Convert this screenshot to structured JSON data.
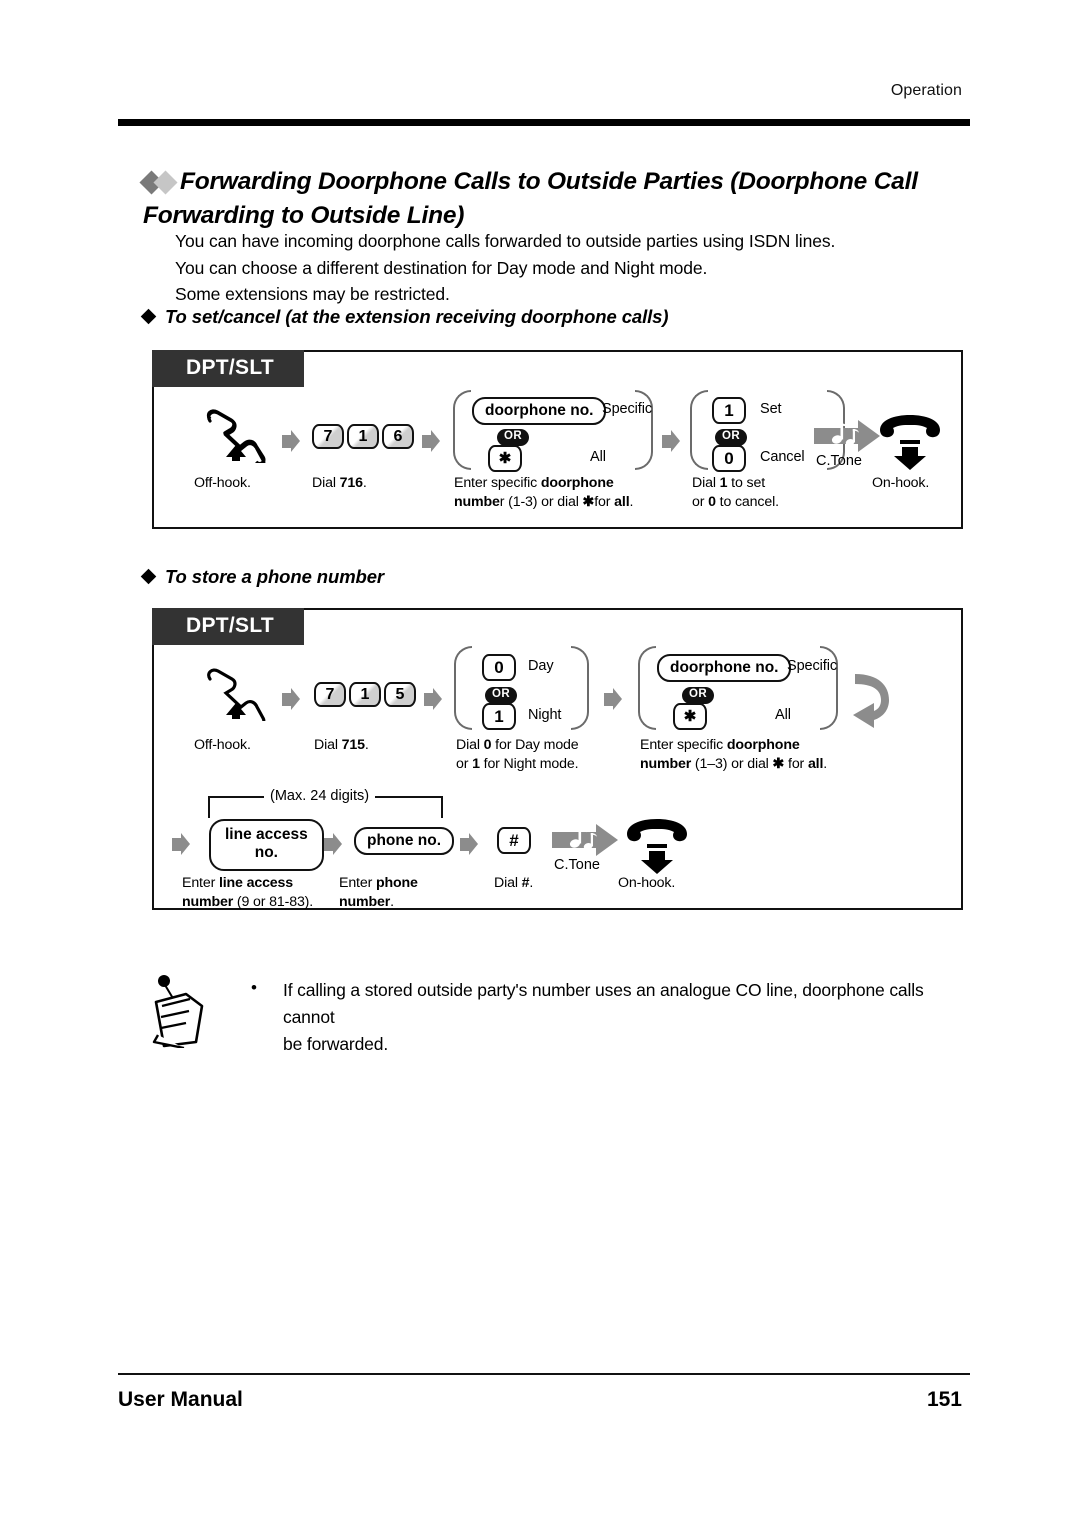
{
  "header": {
    "running_head": "Operation"
  },
  "section": {
    "title": "Forwarding Doorphone Calls to Outside Parties (Doorphone Call Forwarding to Outside Line)",
    "intro_lines": [
      "You can have incoming doorphone calls forwarded to outside parties using ISDN lines.",
      "You can choose a different destination for Day mode and Night mode.",
      "Some extensions may be restricted."
    ]
  },
  "proc1": {
    "heading": "To set/cancel (at the extension receiving doorphone calls)",
    "banner": "DPT/SLT",
    "steps": {
      "offhook_caption": "Off-hook.",
      "dial_keys": [
        "7",
        "1",
        "6"
      ],
      "dial_caption_pre": "Dial ",
      "dial_caption_code": "716",
      "dial_caption_post": ".",
      "group1": {
        "pill": "doorphone no.",
        "pill_side": "Specific",
        "or": "OR",
        "star": "✱",
        "star_side": "All",
        "caption_l1_a": "Enter specific ",
        "caption_l1_b": "doorphone",
        "caption_l2_a": "numbe",
        "caption_l2_b": "r (1-3) or dial  ",
        "caption_l2_c": "✱",
        "caption_l2_d": "for ",
        "caption_l2_e": "all",
        "caption_l2_f": "."
      },
      "group2": {
        "key_top": "1",
        "key_top_side": "Set",
        "or": "OR",
        "key_bottom": "0",
        "key_bottom_side": "Cancel",
        "caption_l1_a": "Dial ",
        "caption_l1_b": "1",
        "caption_l1_c": " to set",
        "caption_l2_a": "or ",
        "caption_l2_b": "0",
        "caption_l2_c": " to cancel."
      },
      "ctone_label": "C.Tone",
      "onhook_caption": "On-hook."
    }
  },
  "proc2": {
    "heading": "To store a phone number",
    "banner": "DPT/SLT",
    "steps": {
      "offhook_caption": "Off-hook.",
      "dial_keys": [
        "7",
        "1",
        "5"
      ],
      "dial_caption_pre": "Dial ",
      "dial_caption_code": "715",
      "dial_caption_post": ".",
      "group1": {
        "key_top": "0",
        "key_top_side": "Day",
        "or": "OR",
        "key_bottom": "1",
        "key_bottom_side": "Night",
        "caption_l1_a": "Dial ",
        "caption_l1_b": "0",
        "caption_l1_c": " for Day mode",
        "caption_l2_a": "or ",
        "caption_l2_b": "1",
        "caption_l2_c": " for Night mode."
      },
      "group2": {
        "pill": "doorphone no.",
        "pill_side": "Specific",
        "or": "OR",
        "star": "✱",
        "star_side": "All",
        "caption_l1_a": "Enter specific ",
        "caption_l1_b": "doorphone",
        "caption_l2_a": "number",
        "caption_l2_b": " (1–3) or dial ",
        "caption_l2_c": "✱",
        "caption_l2_d": " for ",
        "caption_l2_e": "all",
        "caption_l2_f": "."
      },
      "max_digits": "(Max. 24 digits)",
      "line_access_pill_l1": "line access",
      "line_access_pill_l2": "no.",
      "line_access_cap_l1_a": "Enter ",
      "line_access_cap_l1_b": "line access",
      "line_access_cap_l2_a": "number",
      "line_access_cap_l2_b": " (9 or 81-83).",
      "phone_pill": "phone no.",
      "phone_cap_l1_a": "Enter ",
      "phone_cap_l1_b": "phone",
      "phone_cap_l2_a": "number",
      "phone_cap_l2_b": ".",
      "hash_key": "#",
      "hash_cap_a": "Dial ",
      "hash_cap_b": "#",
      "hash_cap_c": ".",
      "ctone_label": "C.Tone",
      "onhook_caption": "On-hook."
    }
  },
  "note": {
    "bullet": "•",
    "line1": "If calling a stored outside party's number uses an analogue CO line, doorphone calls cannot",
    "line2": "be forwarded."
  },
  "footer": {
    "left": "User Manual",
    "page": "151"
  }
}
